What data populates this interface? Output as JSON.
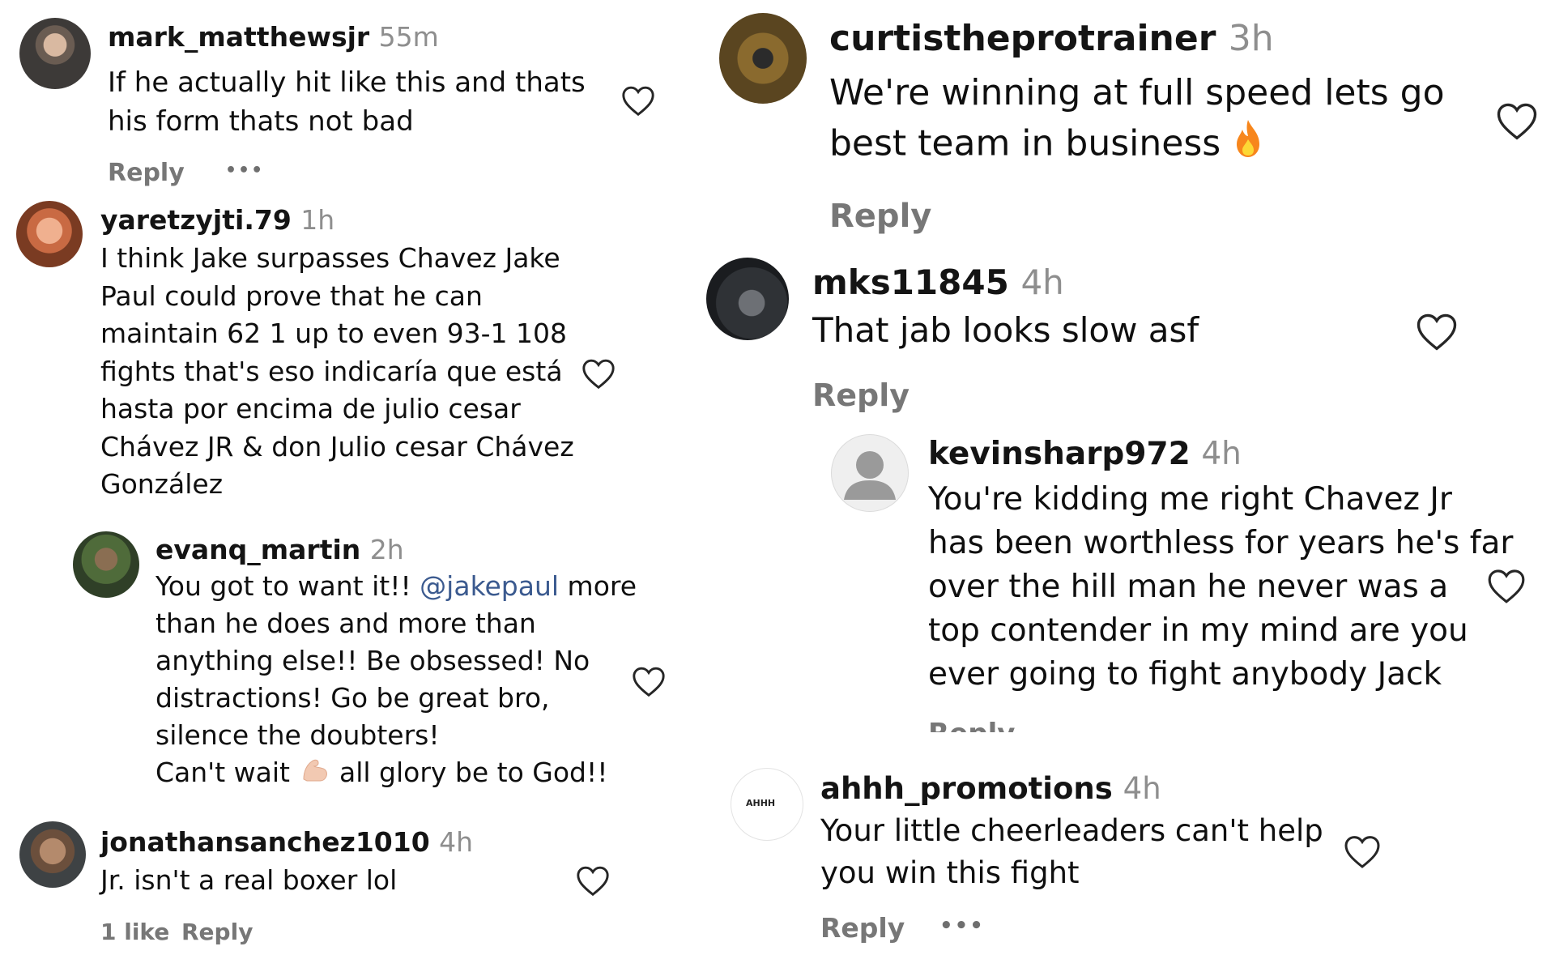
{
  "left_column": [
    {
      "username": "mark_matthewsjr",
      "time": "55m",
      "lines": [
        "If he actually hit like this and thats",
        "his form thats not bad"
      ],
      "reply_label": "Reply",
      "more_label": "•••"
    },
    {
      "username": "yaretzyjti.79",
      "time": "1h",
      "lines": [
        "I think Jake surpasses Chavez Jake",
        "Paul could prove that he can",
        "maintain 62 1 up to even 93-1 108",
        "fights that's eso indicaría que está",
        "hasta por encima de julio cesar",
        "Chávez JR & don Julio cesar Chávez",
        "González"
      ]
    },
    {
      "username": "evanq_martin",
      "time": "2h",
      "line1_before": "You got to want it!! ",
      "mention": "@jakepaul",
      "line1_after": " more",
      "lines": [
        "than he does and more than",
        "anything else!! Be obsessed! No",
        "distractions! Go be great bro,",
        "silence the doubters!"
      ],
      "last_before": "Can't wait ",
      "last_after": " all glory be to God!!"
    },
    {
      "username": "jonathansanchez1010",
      "time": "4h",
      "lines": [
        "Jr. isn't a real boxer lol"
      ],
      "likes_label": "1 like",
      "reply_label": "Reply"
    }
  ],
  "right_column": [
    {
      "username": "curtistheprotrainer",
      "time": "3h",
      "lines": [
        "We're winning at full speed lets go",
        "best team in business "
      ],
      "reply_label": "Reply"
    },
    {
      "username": "mks11845",
      "time": "4h",
      "lines": [
        "That jab looks slow asf"
      ],
      "reply_label": "Reply"
    },
    {
      "username": "kevinsharp972",
      "time": "4h",
      "lines": [
        "You're kidding me right Chavez Jr",
        "has been worthless for years he's far",
        "over the hill man he never was a",
        "top contender in my mind are you",
        "ever going to fight anybody Jack"
      ],
      "reply_label": "Reply"
    },
    {
      "username": "ahhh_promotions",
      "time": "4h",
      "avatar_text": "AHHH",
      "lines": [
        "Your little cheerleaders can't help",
        "you win this fight"
      ],
      "reply_label": "Reply",
      "more_label": "•••"
    }
  ],
  "icons": {
    "heart": "heart-outline-icon",
    "fire": "fire-emoji-icon",
    "muscle": "flexed-biceps-emoji-icon",
    "default_avatar": "default-user-icon"
  },
  "colors": {
    "username": "#141414",
    "timestamp": "#8e8e8e",
    "reply": "#777777",
    "mention": "#3b5a8f",
    "heart_stroke": "#262626"
  }
}
